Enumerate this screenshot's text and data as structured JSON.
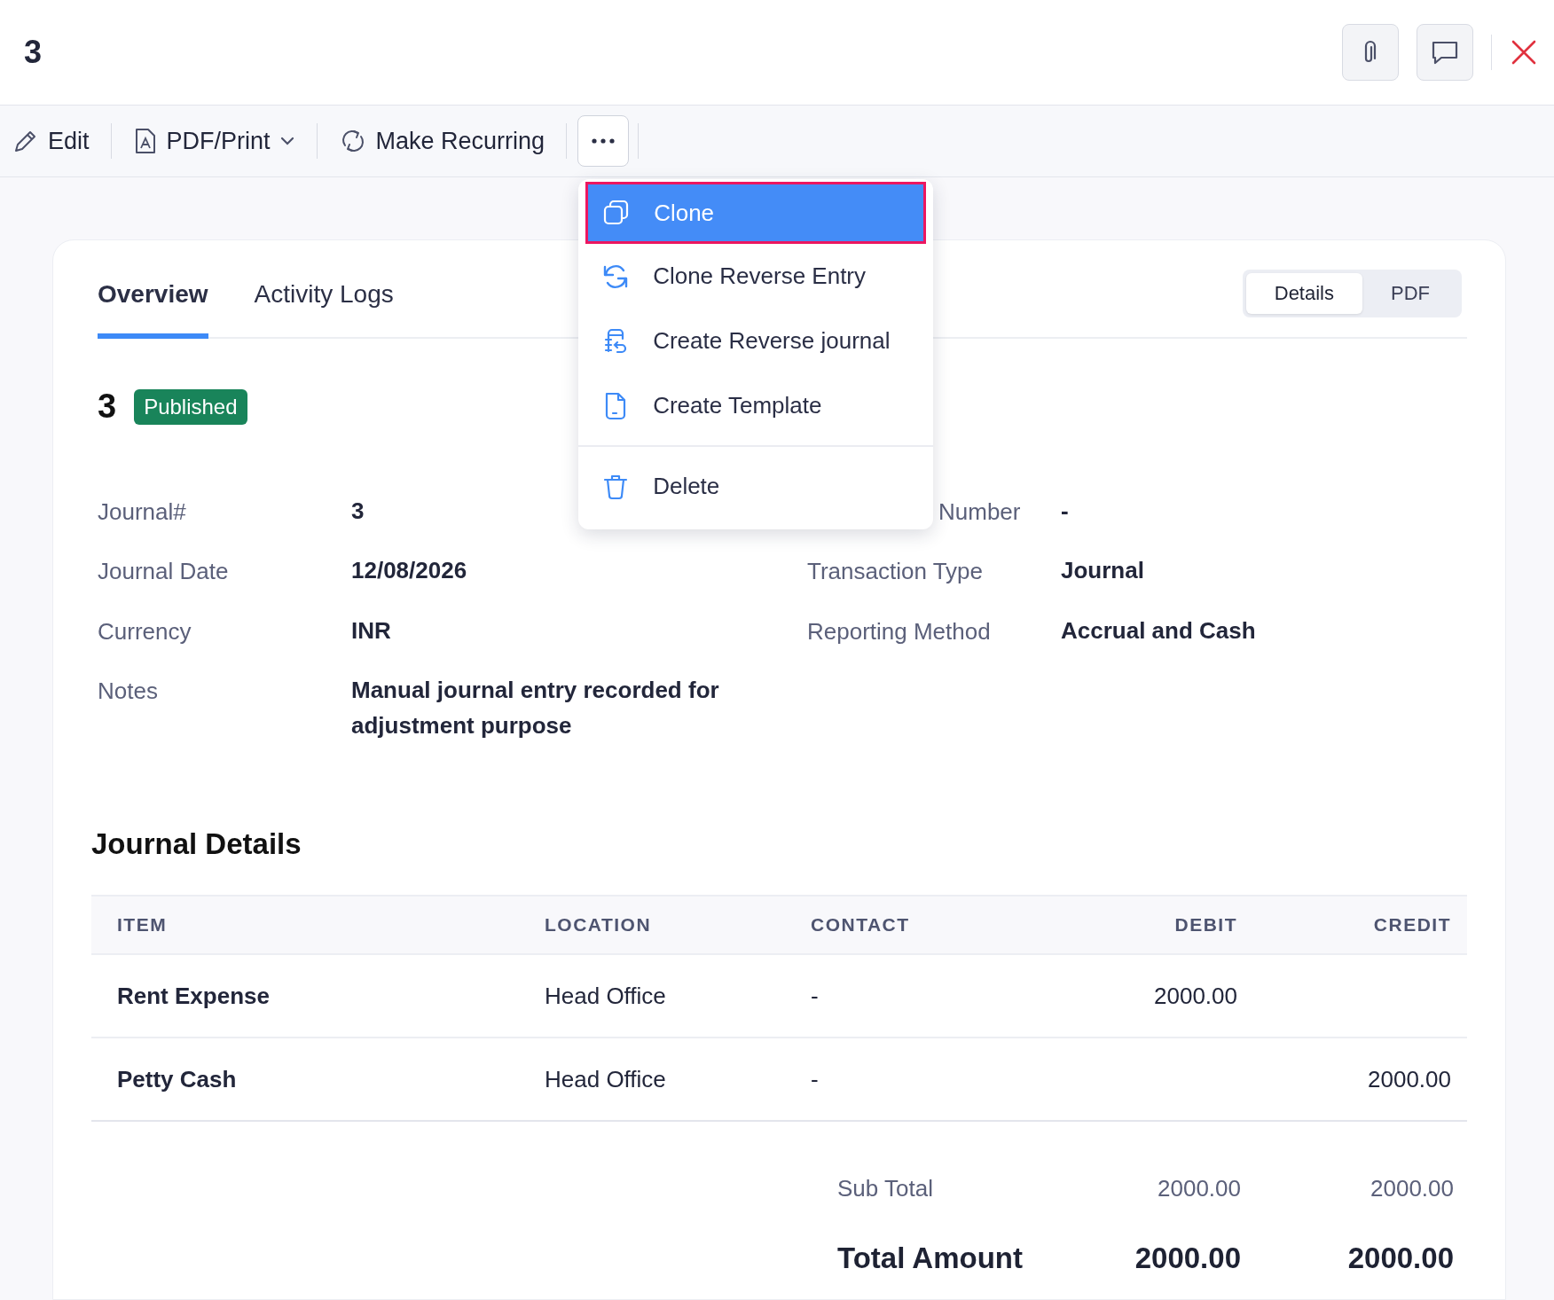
{
  "title": "3",
  "toolbar": [
    {
      "kind": "edit",
      "label": "Edit",
      "dropdown": false
    },
    {
      "kind": "pdf",
      "label": "PDF/Print",
      "dropdown": true
    },
    {
      "kind": "recurring",
      "label": "Make Recurring",
      "dropdown": false
    }
  ],
  "more_menu": {
    "expanded": true,
    "items": [
      {
        "kind": "clone",
        "label": "Clone",
        "selected": true
      },
      {
        "kind": "clone-reverse",
        "label": "Clone Reverse Entry",
        "selected": false
      },
      {
        "kind": "reverse-journal",
        "label": "Create Reverse journal",
        "selected": false
      },
      {
        "kind": "template",
        "label": "Create Template",
        "selected": false
      },
      {
        "kind": "delete",
        "label": "Delete",
        "selected": false
      }
    ]
  },
  "tabs": [
    {
      "label": "Overview",
      "selected": true
    },
    {
      "label": "Activity Logs",
      "selected": false
    }
  ],
  "view_toggle": [
    {
      "label": "Details",
      "selected": true
    },
    {
      "label": "PDF",
      "selected": false
    }
  ],
  "journal": {
    "number": "3",
    "status": "Published"
  },
  "fields_left": [
    {
      "label": "Journal#",
      "value": "3"
    },
    {
      "label": "Journal Date",
      "value": "12/08/2026"
    },
    {
      "label": "Currency",
      "value": "INR"
    },
    {
      "label": "Notes",
      "value": "Manual journal entry recorded for adjustment purpose"
    }
  ],
  "fields_right": [
    {
      "label": "Number",
      "value": "-"
    },
    {
      "label": "Transaction Type",
      "value": "Journal"
    },
    {
      "label": "Reporting Method",
      "value": "Accrual and Cash"
    }
  ],
  "section_title": "Journal Details",
  "table": {
    "columns": [
      "ITEM",
      "LOCATION",
      "CONTACT",
      "DEBIT",
      "CREDIT"
    ],
    "rows": [
      {
        "item": "Rent Expense",
        "location": "Head Office",
        "contact": "-",
        "debit": "2000.00"
      },
      {
        "item": "Petty Cash",
        "location": "Head Office",
        "contact": "-",
        "credit": "2000.00"
      }
    ]
  },
  "totals": [
    {
      "kind": "sub",
      "label": "Sub Total",
      "debit": "2000.00",
      "credit": "2000.00"
    },
    {
      "kind": "total",
      "label": "Total Amount",
      "debit": "2000.00",
      "credit": "2000.00"
    }
  ]
}
